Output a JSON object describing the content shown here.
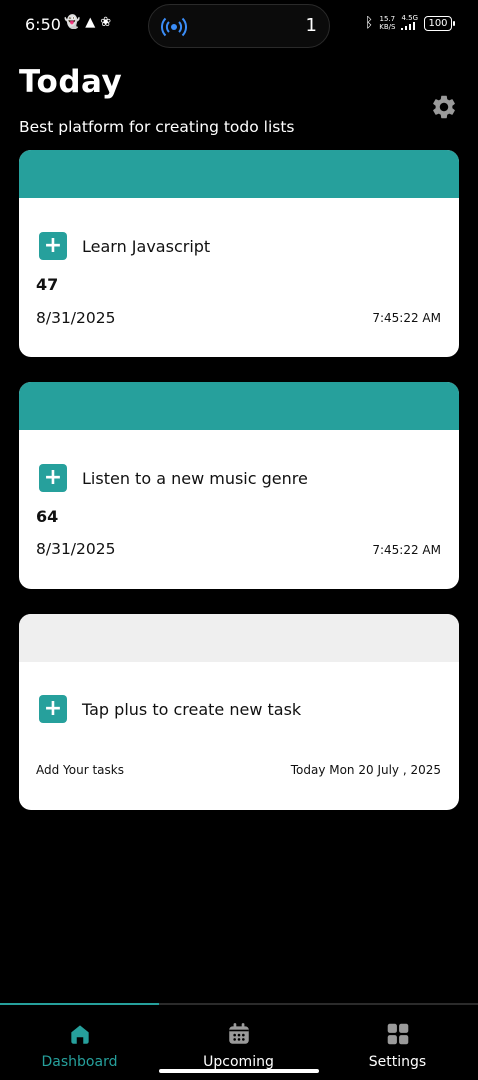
{
  "status_bar": {
    "time": "6:50",
    "notif_icons": [
      "snapchat-icon",
      "snapchat-icon",
      "pinwheel-icon"
    ],
    "island_count": "1",
    "net_speed_value": "15.7",
    "net_speed_unit": "KB/S",
    "network": "4.5G",
    "battery": "100"
  },
  "header": {
    "title": "Today",
    "subtitle": "Best platform for creating todo lists"
  },
  "tasks": [
    {
      "title": "Learn Javascript",
      "number": "47",
      "date": "8/31/2025",
      "time": "7:45:22 AM",
      "band_color": "#26a09c"
    },
    {
      "title": "Listen to a new music genre",
      "number": "64",
      "date": "8/31/2025",
      "time": "7:45:22 AM",
      "band_color": "#26a09c"
    }
  ],
  "add_card": {
    "title": "Tap plus to create new task",
    "hint": "Add Your tasks",
    "date_text": "Today Mon 20 July , 2025",
    "band_color": "#efefef"
  },
  "nav": {
    "items": [
      {
        "label": "Dashboard",
        "icon": "home-icon",
        "active": true
      },
      {
        "label": "Upcoming",
        "icon": "calendar-icon",
        "active": false
      },
      {
        "label": "Settings",
        "icon": "grid-icon",
        "active": false
      }
    ]
  },
  "colors": {
    "accent": "#26a09c",
    "inactive_icon": "#9a9a9a",
    "background": "#000000",
    "card": "#ffffff"
  }
}
